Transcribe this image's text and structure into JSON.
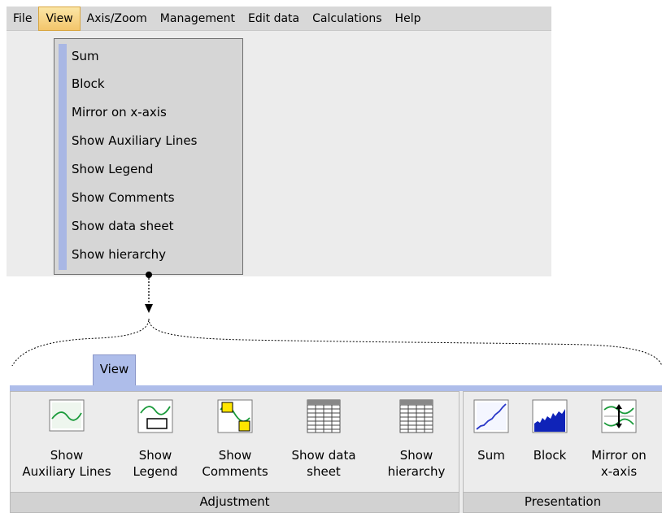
{
  "menubar": {
    "items": [
      "File",
      "View",
      "Axis/Zoom",
      "Management",
      "Edit data",
      "Calculations",
      "Help"
    ]
  },
  "dropdown": {
    "items": [
      "Sum",
      "Block",
      "Mirror on x-axis",
      "Show Auxiliary Lines",
      "Show Legend",
      "Show Comments",
      "Show data sheet",
      "Show hierarchy"
    ]
  },
  "ribbon": {
    "tab": "View",
    "groups": [
      {
        "label": "Adjustment",
        "buttons": [
          {
            "line1": "Show",
            "line2": "Auxiliary Lines",
            "icon": "auxiliary-lines-icon"
          },
          {
            "line1": "Show",
            "line2": "Legend",
            "icon": "legend-icon"
          },
          {
            "line1": "Show",
            "line2": "Comments",
            "icon": "comments-icon"
          },
          {
            "line1": "Show data",
            "line2": "sheet",
            "icon": "data-sheet-icon"
          },
          {
            "line1": "Show",
            "line2": "hierarchy",
            "icon": "hierarchy-icon"
          }
        ]
      },
      {
        "label": "Presentation",
        "buttons": [
          {
            "line1": "Sum",
            "line2": "",
            "icon": "sum-chart-icon"
          },
          {
            "line1": "Block",
            "line2": "",
            "icon": "block-chart-icon"
          },
          {
            "line1": "Mirror on",
            "line2": "x-axis",
            "icon": "mirror-x-axis-icon"
          }
        ]
      }
    ]
  },
  "colors": {
    "menubar": "#d8d8d8",
    "active_menu": "#f3c56b",
    "dropdown": "#d6d6d6",
    "dropdown_stripe": "#a9b7e4",
    "ribbon_tab": "#aebdea",
    "icon_green": "#1a9a3a",
    "icon_yellow": "#ffe600"
  }
}
